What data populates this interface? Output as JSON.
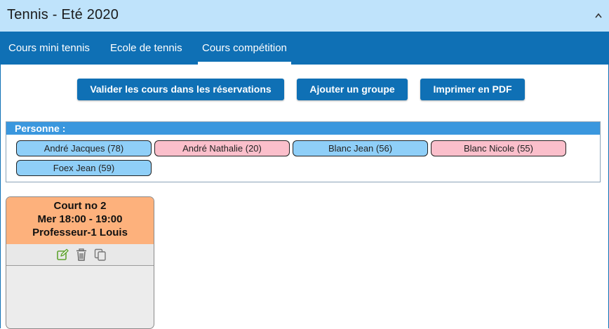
{
  "header": {
    "title": "Tennis - Eté 2020",
    "collapse_icon": "chevron-up-icon"
  },
  "tabs": [
    {
      "label": "Cours mini tennis",
      "active": false
    },
    {
      "label": "Ecole de tennis",
      "active": false
    },
    {
      "label": "Cours compétition",
      "active": true
    }
  ],
  "actions": {
    "validate": "Valider les cours dans les réservations",
    "add_group": "Ajouter un groupe",
    "print_pdf": "Imprimer en PDF"
  },
  "persons": {
    "label": "Personne :",
    "items": [
      {
        "name": "André Jacques (78)",
        "gender": "male"
      },
      {
        "name": "André Nathalie (20)",
        "gender": "female"
      },
      {
        "name": "Blanc Jean (56)",
        "gender": "male"
      },
      {
        "name": "Blanc Nicole (55)",
        "gender": "female"
      },
      {
        "name": "Foex Jean (59)",
        "gender": "male"
      }
    ]
  },
  "course_card": {
    "court": "Court no 2",
    "schedule": "Mer 18:00 - 19:00",
    "teacher": "Professeur-1 Louis",
    "tools": [
      "edit-icon",
      "trash-icon",
      "copy-icon"
    ]
  },
  "colors": {
    "primary": "#0f70b5",
    "header_bg": "#bfe3fb",
    "male_chip": "#8fcff8",
    "female_chip": "#fbbfcb",
    "card_head": "#fdb17c",
    "edit_icon": "#5fa32f"
  }
}
